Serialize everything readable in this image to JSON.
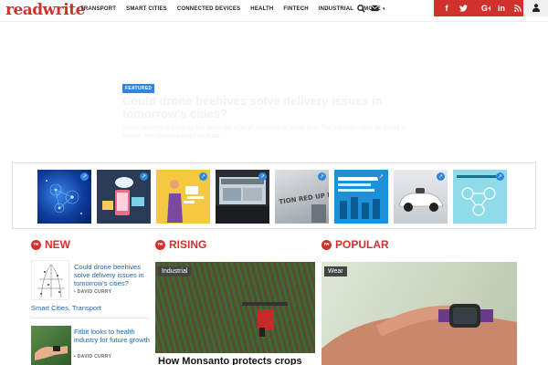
{
  "brand": {
    "logo": "readwrite"
  },
  "nav": {
    "items": [
      "TRANSPORT",
      "SMART CITIES",
      "CONNECTED DEVICES",
      "HEALTH",
      "FINTECH",
      "INDUSTRIAL",
      "MORE"
    ],
    "more_caret": "▾"
  },
  "social": {
    "facebook": "f",
    "twitter": "t",
    "google": "G+",
    "linkedin": "in",
    "rss": "rss"
  },
  "hero": {
    "badge": "FEATURED",
    "title": "Could drone beehives solve delivery issues in tomorrow's cities?",
    "subtitle": "Drone delivery is coming, but there are a lot of problems to solve first. The solution might be found in nature, with beehive-inspired hubs."
  },
  "sections": {
    "new": {
      "title": "NEW",
      "items": [
        {
          "title": "Could drone beehives solve delivery issues in tomorrow's cities?",
          "author": "DAVID CURRY",
          "category": "Smart Cities, Transport"
        },
        {
          "title": "Fitbit looks to health industry for future growth",
          "author": "DAVID CURRY"
        }
      ]
    },
    "rising": {
      "title": "RISING",
      "tag": "Industrial",
      "headline": "How Monsanto protects crops"
    },
    "popular": {
      "title": "POPULAR",
      "tag": "Wear"
    }
  },
  "colors": {
    "brand_red": "#d0312d",
    "link_blue": "#2266aa",
    "accent_blue": "#2e86de"
  }
}
